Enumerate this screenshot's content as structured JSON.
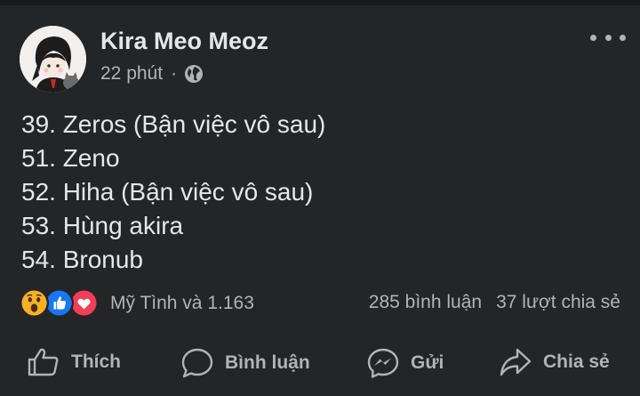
{
  "post": {
    "author": "Kira Meo Meoz",
    "time": "22 phút",
    "separator": "·",
    "privacy_icon": "globe-icon",
    "lines": [
      "39. Zeros (Bận việc vô sau)",
      "51. Zeno",
      "52. Hiha (Bận việc vô sau)",
      "53. Hùng akira",
      "54. Bronub"
    ]
  },
  "reactions": {
    "icons": [
      "wow-reaction-icon",
      "like-reaction-icon",
      "love-reaction-icon"
    ],
    "names": "Mỹ Tình và 1.163",
    "comments": "285 bình luận",
    "shares": "37 lượt chia sẻ"
  },
  "actions": {
    "like": "Thích",
    "comment": "Bình luận",
    "send": "Gửi",
    "share": "Chia sẻ"
  },
  "colors": {
    "background": "#242526",
    "text_primary": "#e4e6eb",
    "text_secondary": "#b0b3b8",
    "like_blue": "#1877f2",
    "love_red": "#f33e58",
    "wow_yellow": "#f7b125"
  }
}
